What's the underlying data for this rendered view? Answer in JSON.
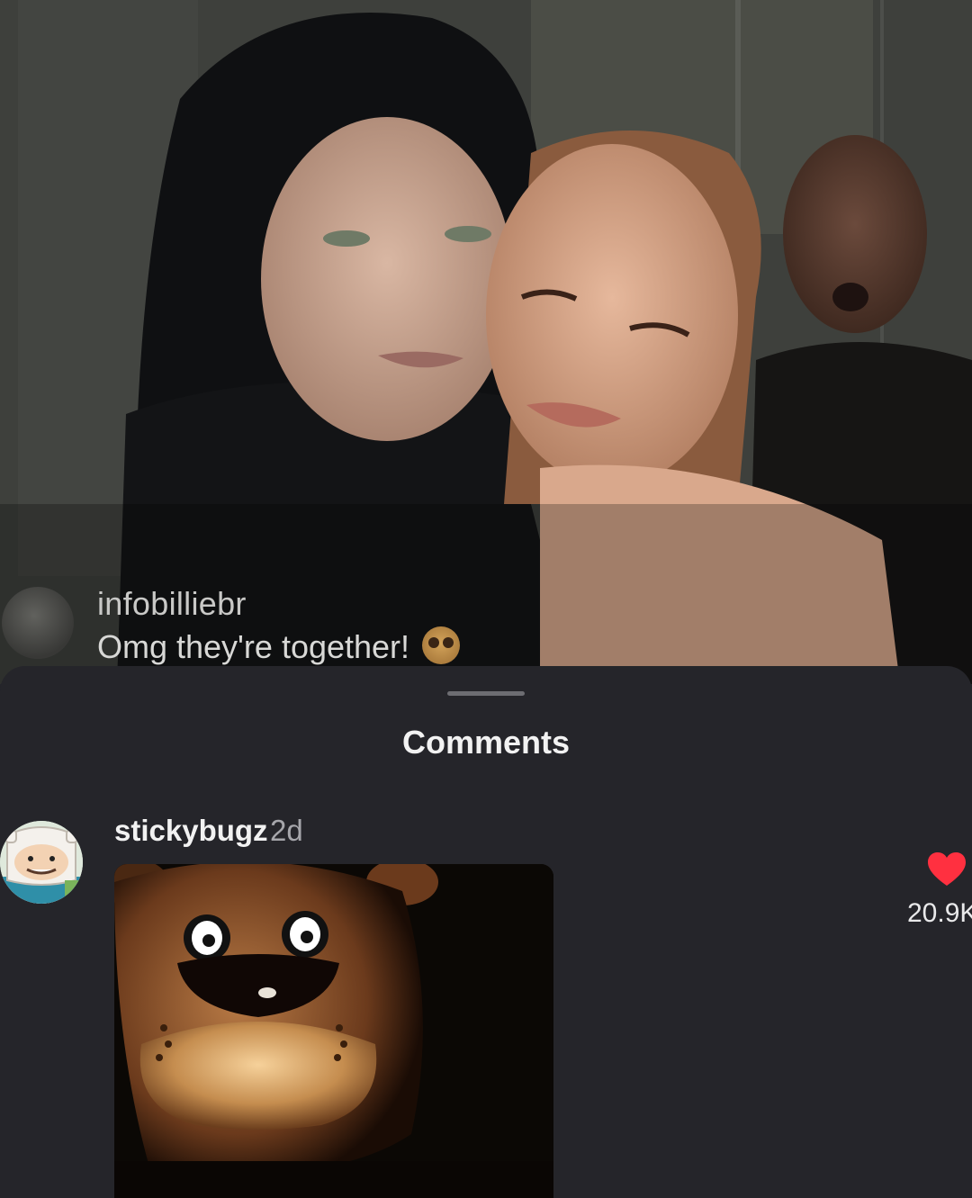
{
  "post": {
    "username": "infobilliebr",
    "caption": "Omg they're together!",
    "caption_emoji": "face-holding-back-tears-emoji"
  },
  "comments_sheet": {
    "title": "Comments",
    "comments": [
      {
        "username": "stickybugz",
        "time": "2d",
        "attachment": "animatronic-bear-gif",
        "likes": "20.9K",
        "liked": true
      }
    ]
  },
  "colors": {
    "sheet_background": "#25252a",
    "heart": "#ff3040",
    "text_primary": "#f2f2f2",
    "text_secondary": "#a6a6ab"
  }
}
